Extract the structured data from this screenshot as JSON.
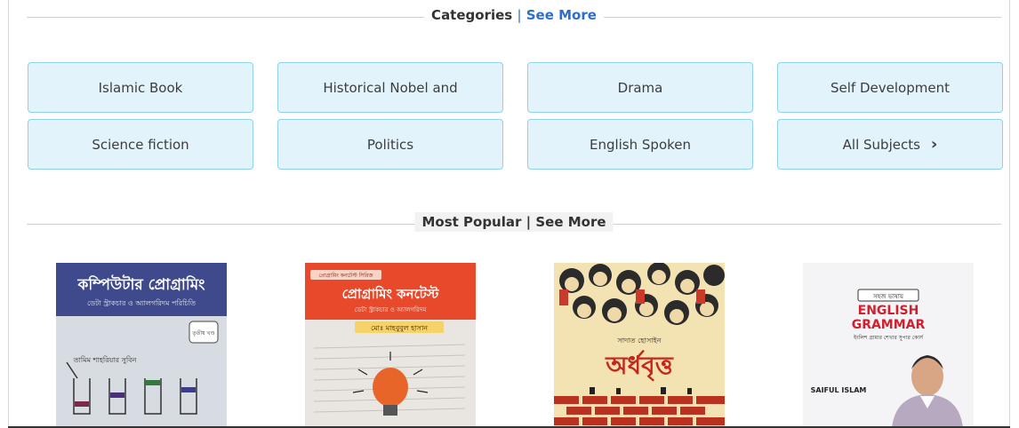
{
  "categories_header": {
    "title": "Categories",
    "separator": "|",
    "see_more": "See More"
  },
  "categories": [
    {
      "label": "Islamic Book"
    },
    {
      "label": "Historical Nobel and"
    },
    {
      "label": "Drama"
    },
    {
      "label": "Self Development"
    },
    {
      "label": "Science fiction"
    },
    {
      "label": "Politics"
    },
    {
      "label": "English Spoken"
    },
    {
      "label": "All Subjects",
      "icon": "chevron-right-icon"
    }
  ],
  "popular_header": {
    "title": "Most Popular",
    "separator": "|",
    "see_more": "See More"
  },
  "books": [
    {
      "title": "কম্পিউটার প্রোগ্রামিং",
      "subtitle": "ডেটা স্ট্রাকচার ও অ্যালগরিদম পরিচিতি",
      "badge": "তৃতীয় খণ্ড",
      "author": "তামিম শাহরিয়ার সুবিন"
    },
    {
      "series": "প্রোগ্রামিং কনটেস্ট সিরিজ",
      "title": "প্রোগ্রামিং কনটেস্ট",
      "subtitle": "ডেটা স্ট্রাকচার ও অ্যালগরিদম",
      "author": "মোঃ মাহবুবুল হাসান"
    },
    {
      "author": "সাদাত হোসাইন",
      "title": "অর্ধবৃত্ত"
    },
    {
      "tag": "সহজ ভাষায়",
      "title_line1": "ENGLISH",
      "title_line2": "GRAMMAR",
      "subtitle": "ইংলিশ গ্রামার শেখার সুপার কোর্স",
      "author": "SAIFUL ISLAM"
    }
  ],
  "colors": {
    "link": "#2c6ecb",
    "category_bg": "#e3f3fb",
    "category_border": "#8fd0ea"
  }
}
